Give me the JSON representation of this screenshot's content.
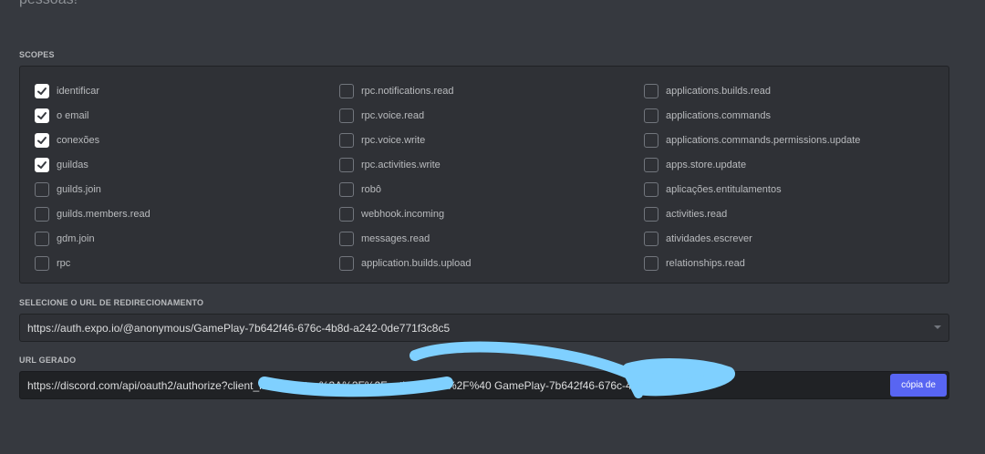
{
  "header": {
    "partial_text": "pessoas!"
  },
  "scopes": {
    "label": "SCOPES",
    "columns": [
      [
        {
          "label": "identificar",
          "checked": true
        },
        {
          "label": "o email",
          "checked": true
        },
        {
          "label": "conexões",
          "checked": true
        },
        {
          "label": "guildas",
          "checked": true
        },
        {
          "label": "guilds.join",
          "checked": false
        },
        {
          "label": "guilds.members.read",
          "checked": false
        },
        {
          "label": "gdm.join",
          "checked": false
        },
        {
          "label": "rpc",
          "checked": false
        }
      ],
      [
        {
          "label": "rpc.notifications.read",
          "checked": false
        },
        {
          "label": "rpc.voice.read",
          "checked": false
        },
        {
          "label": "rpc.voice.write",
          "checked": false
        },
        {
          "label": "rpc.activities.write",
          "checked": false
        },
        {
          "label": "robô",
          "checked": false
        },
        {
          "label": "webhook.incoming",
          "checked": false
        },
        {
          "label": "messages.read",
          "checked": false
        },
        {
          "label": "application.builds.upload",
          "checked": false
        }
      ],
      [
        {
          "label": "applications.builds.read",
          "checked": false
        },
        {
          "label": "applications.commands",
          "checked": false
        },
        {
          "label": "applications.commands.permissions.update",
          "checked": false
        },
        {
          "label": "apps.store.update",
          "checked": false
        },
        {
          "label": "aplicações.entitulamentos",
          "checked": false
        },
        {
          "label": "activities.read",
          "checked": false
        },
        {
          "label": "atividades.escrever",
          "checked": false
        },
        {
          "label": "relationships.read",
          "checked": false
        }
      ]
    ]
  },
  "redirect": {
    "label": "SELECIONE O URL DE REDIRECIONAMENTO",
    "value": "https://auth.expo.io/@anonymous/GamePlay-7b642f46-676c-4b8d-a242-0de771f3c8c5"
  },
  "generated": {
    "label": "URL GERADO",
    "url": "https://discord.com/api/oauth2/authorize?client_id=913                                             https%3A%2F%2Fauth.expo.io%2F%40                                GamePlay-7b642f46-676c-4b8d-a24...",
    "copy_label": "cópia de"
  },
  "colors": {
    "background": "#36393f",
    "panel": "#2f3136",
    "input_dark": "#202225",
    "accent": "#5865f2",
    "redaction": "#7fd0ff"
  }
}
